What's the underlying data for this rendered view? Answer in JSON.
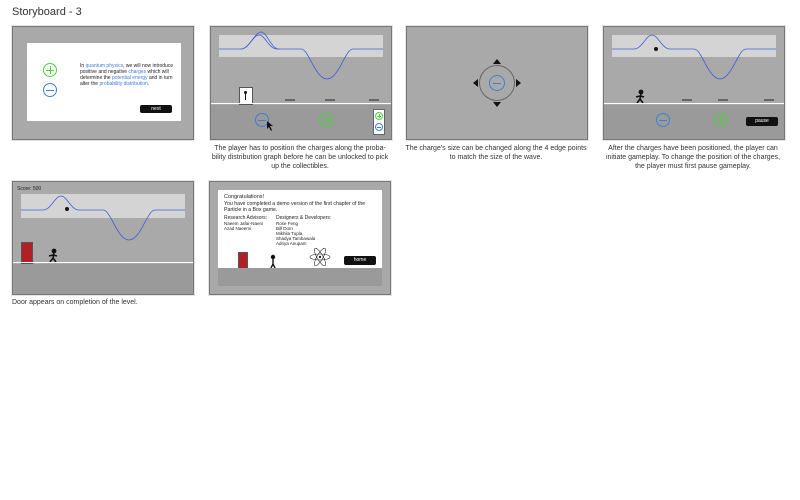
{
  "page": {
    "title": "Storyboard - 3"
  },
  "panel1": {
    "intro_parts": [
      "In ",
      "quantum physics",
      ", we will now introduce positive and negative ",
      "charges",
      " which will determine the ",
      "potential energy",
      " and in turn alter the ",
      "probability distribution",
      "."
    ],
    "next_label": "next"
  },
  "panel2": {
    "caption": "The player has to position the charges along the proba-bility distribution graph before he can be unlocked to pick up the collectibles."
  },
  "panel3": {
    "caption": "The charge's size can be changed along the 4 edge points to match the size of the wave."
  },
  "panel4": {
    "pause_label": "pause",
    "caption": "After the charges have been positioned, the player can initiate gameplay. To change the position of the charges, the player must first pause gameplay."
  },
  "panel5": {
    "score": "Score: 500",
    "caption": "Door appears on completion of the level."
  },
  "panel6": {
    "congrats_title": "Congratulations!",
    "congrats_text": "You have completed a demo version of the first chapter of the Particle in a Box game.",
    "advisors_heading": "Research Advisors:",
    "advisors": [
      "Naeem Jafar-Naeni",
      "Azad Naeemi"
    ],
    "developers_heading": "Designers & Developers:",
    "developers": [
      "Rose Feng",
      "Bill Dom",
      "Mikhila Tupla",
      "Shadya Tambawala",
      "Adriya Anupam"
    ],
    "home_label": "home"
  },
  "colors": {
    "wave": "#3e5fd6",
    "positive": "#4bd13c",
    "negative": "#3e7fd6"
  }
}
